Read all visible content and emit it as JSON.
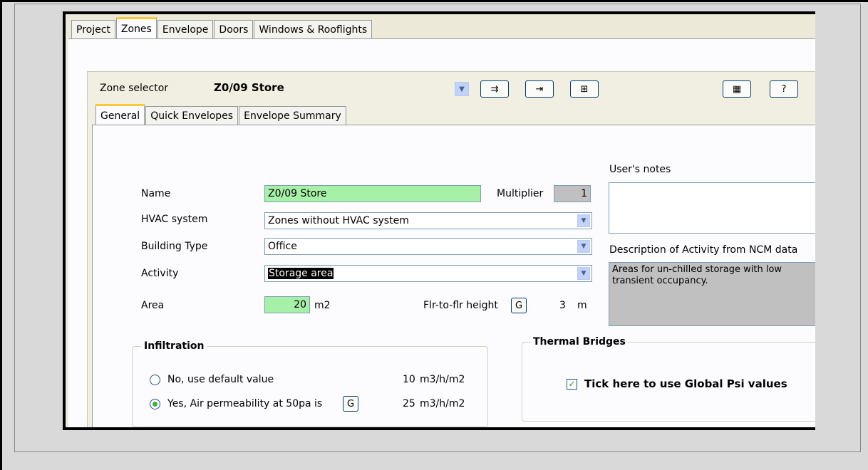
{
  "tabs": [
    "Project",
    "Zones",
    "Envelope",
    "Doors",
    "Windows & Rooflights"
  ],
  "zone_selector": {
    "label": "Zone selector",
    "value": "Z0/09 Store"
  },
  "toolbar": {
    "btn1": "⇉",
    "btn2": "⇥",
    "btn3": "⊞",
    "btn4": "▦",
    "btn5": "?"
  },
  "subtabs": [
    "General",
    "Quick Envelopes",
    "Envelope Summary"
  ],
  "general": {
    "name_label": "Name",
    "name_value": "Z0/09 Store",
    "multiplier_label": "Multiplier",
    "multiplier_value": "1",
    "hvac_label": "HVAC system",
    "hvac_value": "Zones without HVAC system",
    "building_type_label": "Building Type",
    "building_type_value": "Office",
    "activity_label": "Activity",
    "activity_value": "Storage area",
    "area_label": "Area",
    "area_value": "20",
    "area_unit": "m2",
    "flr_label": "Flr-to-flr height",
    "g_label": "G",
    "flr_value": "3",
    "flr_unit": "m",
    "notes_label": "User's notes",
    "desc_label": "Description of Activity from NCM data",
    "desc_value": "Areas for un-chilled storage with low transient occupancy."
  },
  "infiltration": {
    "title": "Infiltration",
    "option1": "No, use default value",
    "option1_value": "10",
    "option1_unit": "m3/h/m2",
    "option2": "Yes, Air permeability at 50pa is",
    "option2_value": "25",
    "option2_unit": "m3/h/m2"
  },
  "thermal": {
    "title": "Thermal Bridges",
    "checkbox_label": "Tick here to use Global Psi values"
  }
}
